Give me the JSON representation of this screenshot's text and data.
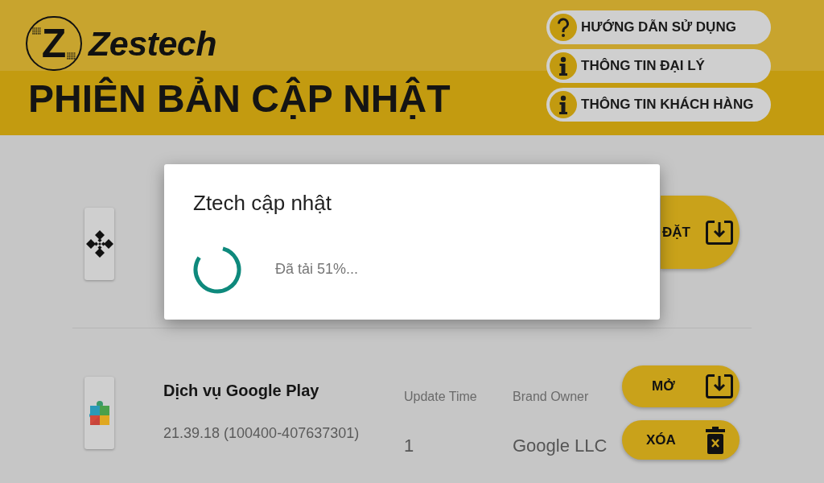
{
  "header": {
    "logo_mark": "Z",
    "brand": "Zestech",
    "title": "PHIÊN BẢN CẬP NHẬT",
    "links": [
      {
        "kind": "help",
        "label": "HƯỚNG DẪN SỬ DỤNG"
      },
      {
        "kind": "info",
        "label": "THÔNG TIN ĐẠI LÝ"
      },
      {
        "kind": "info",
        "label": "THÔNG TIN KHÁCH HÀNG"
      }
    ]
  },
  "apps": [
    {
      "actions": [
        {
          "kind": "install",
          "label": "ĐẶT"
        }
      ]
    },
    {
      "name": "Dịch vụ Google Play",
      "version": "21.39.18 (100400-407637301)",
      "fields": [
        {
          "label": "Update Time",
          "value": "1"
        },
        {
          "label": "Brand Owner",
          "value": "Google LLC"
        }
      ],
      "actions": [
        {
          "kind": "open",
          "label": "MỞ"
        },
        {
          "kind": "delete",
          "label": "XÓA"
        }
      ]
    }
  ],
  "dialog": {
    "title": "Ztech cập nhật",
    "message": "Đã tải 51%..."
  }
}
